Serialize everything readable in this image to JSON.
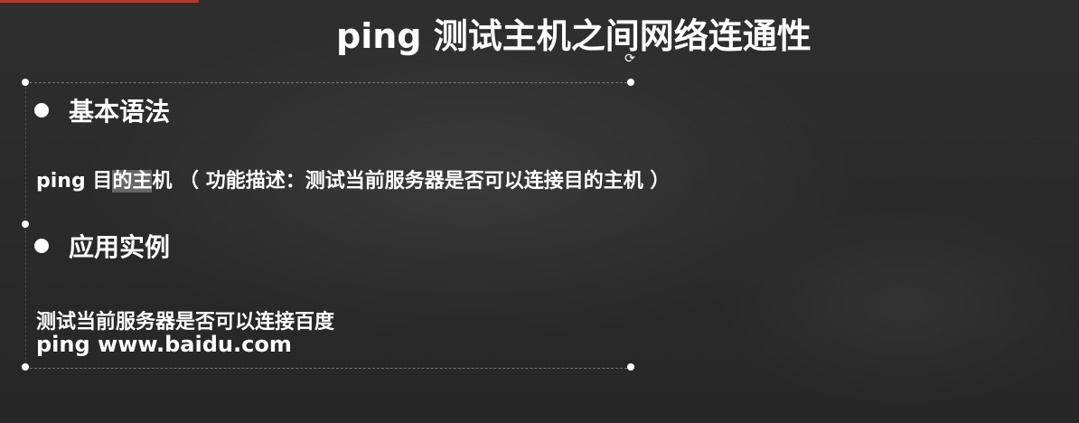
{
  "slide": {
    "title": "ping 测试主机之间网络连通性",
    "section1": {
      "heading": "基本语法",
      "syntax_prefix": "ping 目",
      "syntax_highlight": "的主",
      "syntax_suffix": "机 （ 功能描述：测试当前服务器是否可以连接目的主机 ）"
    },
    "section2": {
      "heading": "应用实例",
      "example_desc": "测试当前服务器是否可以连接百度",
      "example_cmd": "ping www.baidu.com"
    }
  },
  "colors": {
    "background": "#2a2a2a",
    "text": "#ffffff",
    "highlight": "#969696",
    "top_accent": "#b23a2e"
  },
  "icons": {
    "rotate": "rotate-handle-icon",
    "bullet": "bullet-dot-icon"
  }
}
